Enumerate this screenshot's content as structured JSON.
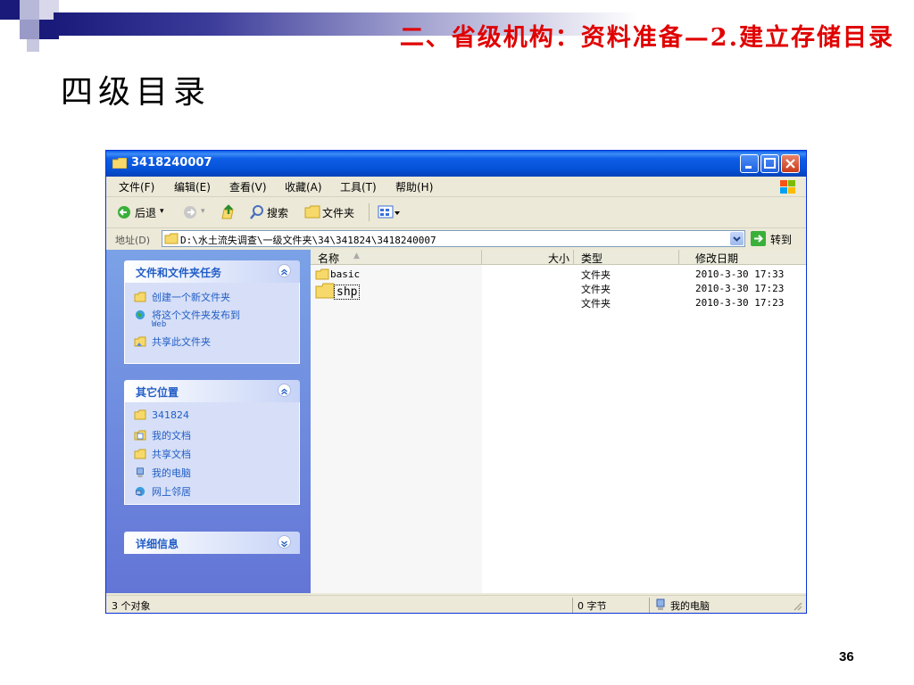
{
  "slide": {
    "header": "二、省级机构：资料准备—2.建立存储目录",
    "title": "四级目录",
    "page_number": "36"
  },
  "window": {
    "title": "3418240007",
    "menu": [
      "文件(F)",
      "编辑(E)",
      "查看(V)",
      "收藏(A)",
      "工具(T)",
      "帮助(H)"
    ],
    "toolbar": {
      "back": "后退",
      "search": "搜索",
      "folders": "文件夹"
    },
    "address": {
      "label": "地址(D)",
      "value": "D:\\水土流失调查\\一级文件夹\\34\\341824\\3418240007",
      "go": "转到"
    },
    "tasks_panel": {
      "title": "文件和文件夹任务",
      "items": [
        "创建一个新文件夹",
        "将这个文件夹发布到",
        "Web",
        "共享此文件夹"
      ]
    },
    "places_panel": {
      "title": "其它位置",
      "items": [
        "341824",
        "我的文档",
        "共享文档",
        "我的电脑",
        "网上邻居"
      ]
    },
    "details_panel": {
      "title": "详细信息"
    },
    "columns": [
      "名称",
      "大小",
      "类型",
      "修改日期"
    ],
    "rows": [
      {
        "name": "basic",
        "type": "文件夹",
        "date": "2010-3-30 17:33"
      },
      {
        "name": "shp",
        "type": "文件夹",
        "date": "2010-3-30 17:23"
      },
      {
        "name": "",
        "type": "文件夹",
        "date": "2010-3-30 17:23"
      }
    ],
    "status": {
      "objects": "3 个对象",
      "bytes": "0 字节",
      "location": "我的电脑"
    }
  },
  "colors": {
    "header_red": "#e00000",
    "titlebar_blue": "#0552d8",
    "task_link_blue": "#215dc6",
    "pane_blue": "#7ba2e7"
  }
}
